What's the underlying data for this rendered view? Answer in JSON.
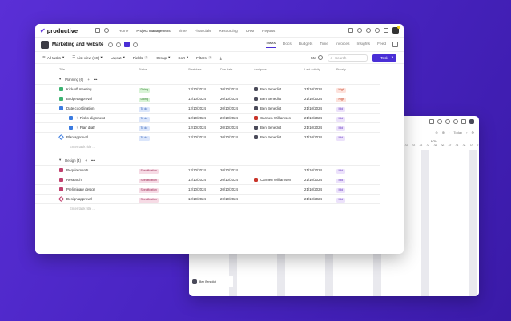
{
  "app": {
    "name": "productive"
  },
  "menu": [
    "Home",
    "Project management",
    "Time",
    "Financials",
    "Resourcing",
    "CRM",
    "Reports"
  ],
  "active_menu": "Project management",
  "project": {
    "title": "Marketing and website"
  },
  "tabs": [
    "Tasks",
    "Docs",
    "Budgets",
    "Time",
    "Invoices",
    "Insights",
    "Feed"
  ],
  "active_tab": "Tasks",
  "toolbar": {
    "all_tasks": "All tasks",
    "list_view": "List view (10)",
    "layout": "Layout",
    "fields": "Fields",
    "fields_count": "7",
    "group": "Group",
    "sort": "Sort",
    "filters": "Filters",
    "filters_count": "1",
    "me": "Me",
    "search_placeholder": "Search",
    "task_button": "Task"
  },
  "columns": [
    "Title",
    "Status",
    "Start date",
    "Due date",
    "Assignee",
    "Last activity",
    "Priority"
  ],
  "groups": [
    {
      "name": "Planning (6)",
      "rows": [
        {
          "title": "Kick-off meeting",
          "color": "#3cb371",
          "status": "Doing",
          "status_type": "doing",
          "start": "12/10/2024",
          "due": "20/10/2024",
          "assignee": "Ben Benedict",
          "assignee_avatar": "dark",
          "activity": "21/10/2024",
          "priority": "High",
          "indent": false
        },
        {
          "title": "Budget approval",
          "color": "#3cb371",
          "status": "Doing",
          "status_type": "doing",
          "start": "12/10/2024",
          "due": "20/10/2024",
          "assignee": "Ben Benedict",
          "assignee_avatar": "dark",
          "activity": "21/10/2024",
          "priority": "High",
          "indent": false
        },
        {
          "title": "Date coordination",
          "color": "#3b7be0",
          "status": "To do",
          "status_type": "todo",
          "start": "12/10/2024",
          "due": "20/10/2024",
          "assignee": "Ben Benedict",
          "assignee_avatar": "dark",
          "activity": "21/10/2024",
          "priority": "Mid",
          "indent": false
        },
        {
          "title": "Risks alignment",
          "color": "#3b7be0",
          "status": "To do",
          "status_type": "todo",
          "start": "12/10/2024",
          "due": "20/10/2024",
          "assignee": "Carmen Williamson",
          "assignee_avatar": "red",
          "activity": "21/10/2024",
          "priority": "Mid",
          "indent": true
        },
        {
          "title": "Plan draft",
          "color": "#3b7be0",
          "status": "To do",
          "status_type": "todo",
          "start": "12/10/2024",
          "due": "20/10/2024",
          "assignee": "Ben Benedict",
          "assignee_avatar": "dark",
          "activity": "21/10/2024",
          "priority": "Mid",
          "indent": true
        },
        {
          "title": "Plan approval",
          "color": "#3b7be0",
          "status": "To do",
          "status_type": "todo",
          "start": "12/10/2024",
          "due": "20/10/2024",
          "assignee": "Ben Benedict",
          "assignee_avatar": "dark",
          "activity": "21/10/2024",
          "priority": "Mid",
          "indent": false,
          "milestone": true
        }
      ]
    },
    {
      "name": "Design (4)",
      "rows": [
        {
          "title": "Requirements",
          "color": "#c0406e",
          "status": "Specification",
          "status_type": "spec",
          "start": "12/10/2024",
          "due": "20/10/2024",
          "assignee": "",
          "assignee_avatar": "",
          "activity": "21/10/2024",
          "priority": "Mid",
          "indent": false
        },
        {
          "title": "Research",
          "color": "#c0406e",
          "status": "Specification",
          "status_type": "spec",
          "start": "12/10/2024",
          "due": "20/10/2024",
          "assignee": "Carmen Williamson",
          "assignee_avatar": "red",
          "activity": "21/10/2024",
          "priority": "Mid",
          "indent": false
        },
        {
          "title": "Preliminary design",
          "color": "#c0406e",
          "status": "Specification",
          "status_type": "spec",
          "start": "12/10/2024",
          "due": "20/10/2024",
          "assignee": "",
          "assignee_avatar": "",
          "activity": "21/10/2024",
          "priority": "Mid",
          "indent": false
        },
        {
          "title": "Design approval",
          "color": "#c0406e",
          "status": "Specification",
          "status_type": "spec",
          "start": "12/10/2024",
          "due": "20/10/2024",
          "assignee": "",
          "assignee_avatar": "",
          "activity": "21/10/2024",
          "priority": "Mid",
          "indent": false,
          "milestone": true
        }
      ]
    }
  ],
  "enter_task_placeholder": "Enter task title ...",
  "background_window": {
    "today": "Today",
    "month": "NOV",
    "days": [
      "01",
      "02",
      "03",
      "04",
      "05",
      "06",
      "07",
      "08",
      "09",
      "10",
      "11",
      "12"
    ],
    "footer_user": "Ben Benedict"
  }
}
